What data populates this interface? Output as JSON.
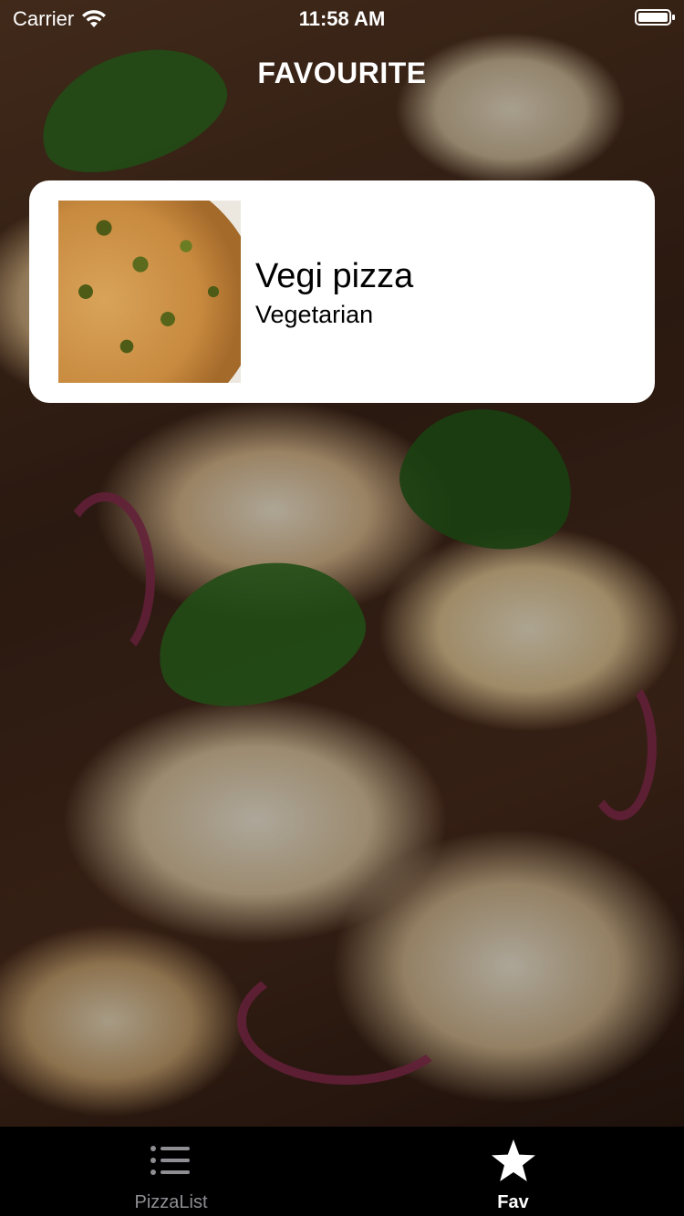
{
  "status_bar": {
    "carrier": "Carrier",
    "time": "11:58 AM"
  },
  "header": {
    "title": "FAVOURITE"
  },
  "favourites": [
    {
      "name": "Vegi pizza",
      "category": "Vegetarian"
    }
  ],
  "tabbar": {
    "tabs": [
      {
        "label": "PizzaList",
        "icon": "list-icon",
        "selected": false
      },
      {
        "label": "Fav",
        "icon": "star-icon",
        "selected": true
      }
    ]
  },
  "colors": {
    "tab_selected": "#ffffff",
    "tab_unselected": "#8e8e93",
    "tabbar_bg": "#000000",
    "card_bg": "#ffffff"
  }
}
